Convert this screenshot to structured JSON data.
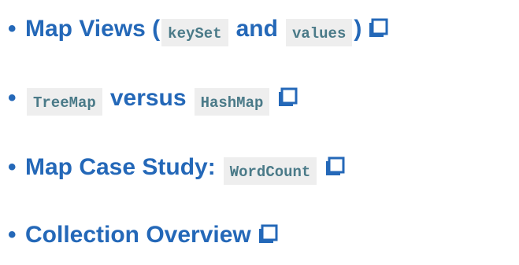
{
  "accent_color": "#2468b8",
  "code_bg": "#eeeeee",
  "items": [
    {
      "bullet": "•",
      "parts": [
        "Map Views (",
        "keySet",
        "and",
        "values",
        ")"
      ],
      "icon": "open-in-new-window-icon"
    },
    {
      "bullet": "•",
      "parts": [
        "TreeMap",
        "versus",
        "HashMap"
      ],
      "icon": "open-in-new-window-icon"
    },
    {
      "bullet": "•",
      "parts": [
        "Map Case Study:",
        "WordCount"
      ],
      "icon": "open-in-new-window-icon"
    },
    {
      "bullet": "•",
      "parts": [
        "Collection Overview"
      ],
      "icon": "open-in-new-window-icon"
    }
  ]
}
